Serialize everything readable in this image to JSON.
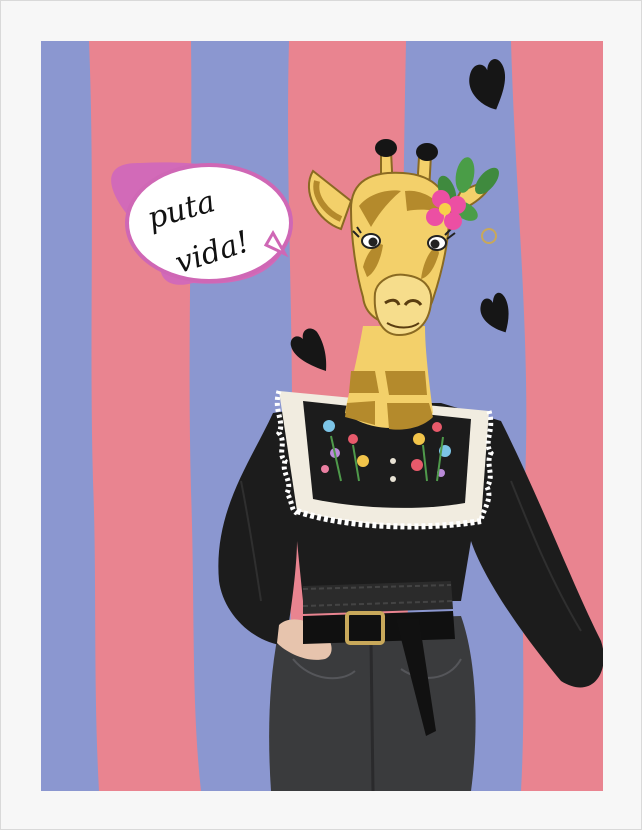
{
  "poster": {
    "speech_bubble": {
      "text_line1": "puta",
      "text_line2": "vida!"
    },
    "colors": {
      "stripe_blue": "#8b97d0",
      "stripe_pink": "#e98490",
      "frame": "#f7f7f7",
      "giraffe_yellow": "#f3d06a",
      "giraffe_brown": "#b48a2c",
      "blouse": "#1c1c1c",
      "lace": "#f1ece0",
      "jeans": "#3a3b3d",
      "flower": "#ec4fa3",
      "leaf": "#3f8a3e",
      "heart": "#161616"
    },
    "icons": [
      "heart-icon",
      "flower-icon"
    ]
  }
}
